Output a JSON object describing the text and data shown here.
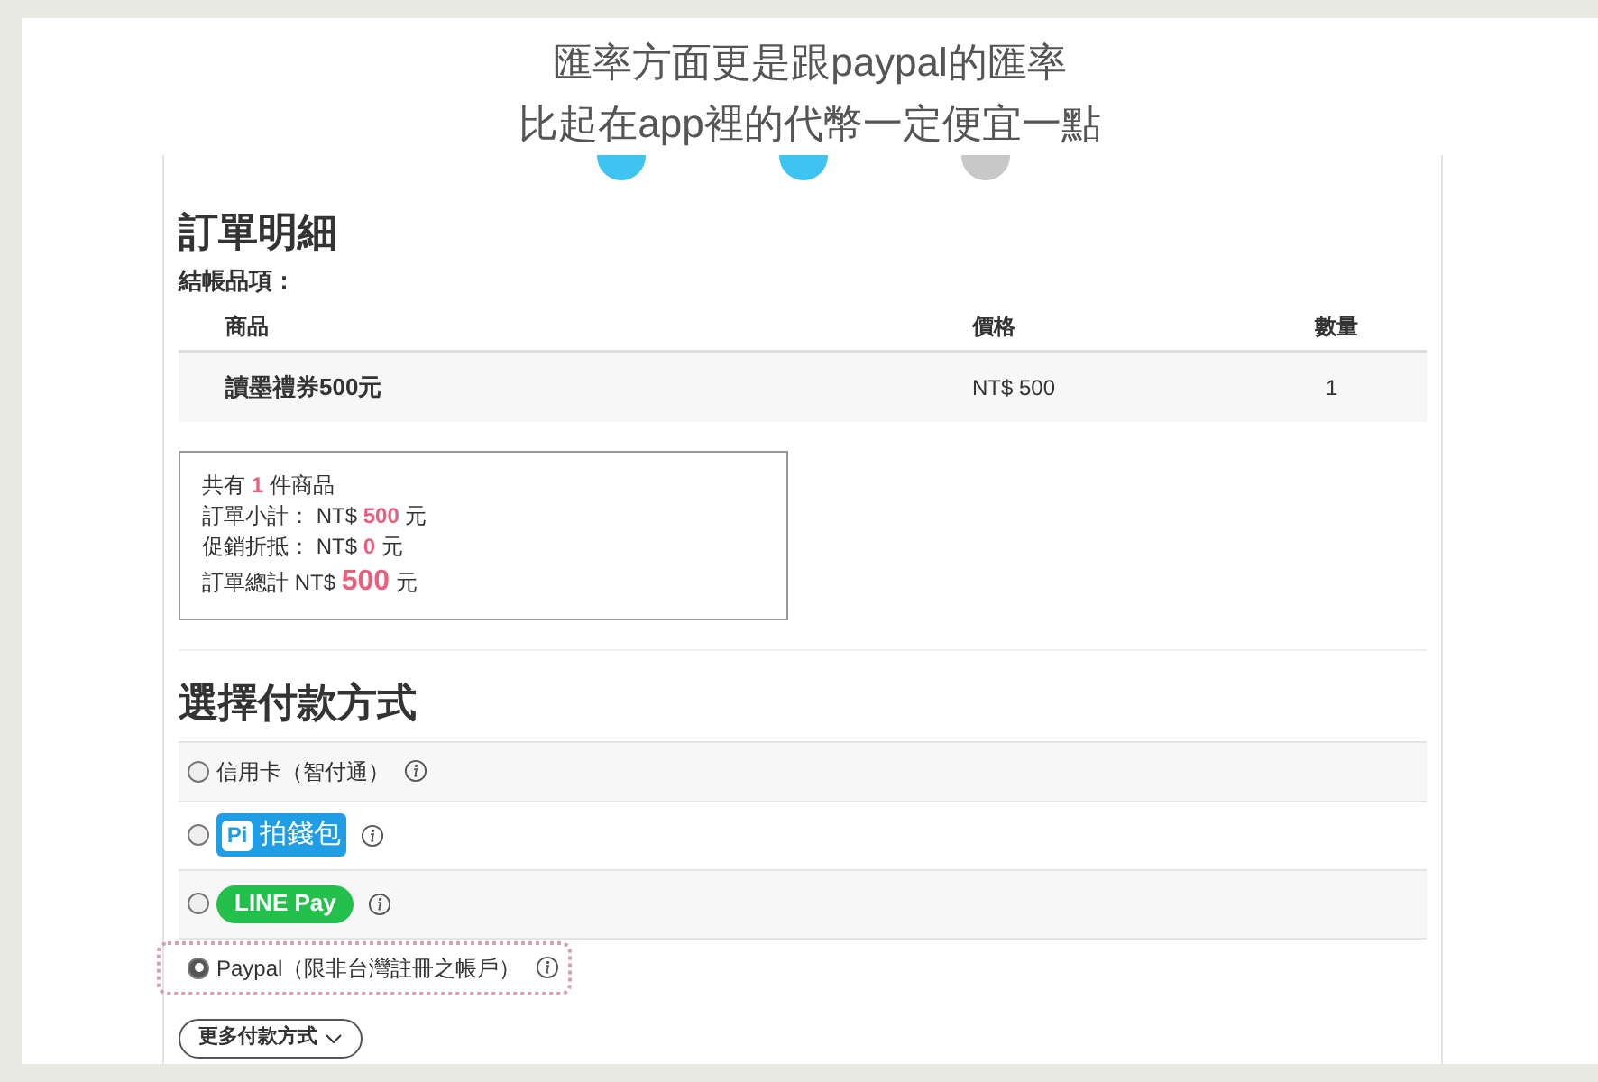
{
  "caption": [
    "匯率方面更是跟paypal的匯率",
    "比起在app裡的代幣一定便宜一點"
  ],
  "steps": [
    {
      "done": true
    },
    {
      "done": true
    },
    {
      "done": false
    }
  ],
  "order": {
    "title": "訂單明細",
    "subtitle": "結帳品項：",
    "columns": [
      "商品",
      "價格",
      "數量"
    ],
    "rows": [
      {
        "item": "讀墨禮券500元",
        "price": "NT$ 500",
        "qty": "1"
      }
    ]
  },
  "summary": [
    {
      "label": "共有",
      "value": "1",
      "unit": "件商品",
      "big": false
    },
    {
      "label": "訂單小計： NT$",
      "value": "500",
      "unit": "元",
      "big": false
    },
    {
      "label": "促銷折抵： NT$",
      "value": "0",
      "unit": "元",
      "big": false
    },
    {
      "label": "訂單總計 NT$",
      "value": "500",
      "unit": "元",
      "big": true
    }
  ],
  "payment": {
    "title": "選擇付款方式",
    "methods": [
      {
        "kind": "text",
        "label": "信用卡（智付通）",
        "selected": false
      },
      {
        "kind": "pi",
        "mark": "Pi",
        "label": "拍錢包",
        "selected": false
      },
      {
        "kind": "linepay",
        "label": "LINE Pay",
        "selected": false
      },
      {
        "kind": "text",
        "label": "Paypal（限非台灣註冊之帳戶）",
        "selected": true
      }
    ],
    "more": "更多付款方式"
  }
}
